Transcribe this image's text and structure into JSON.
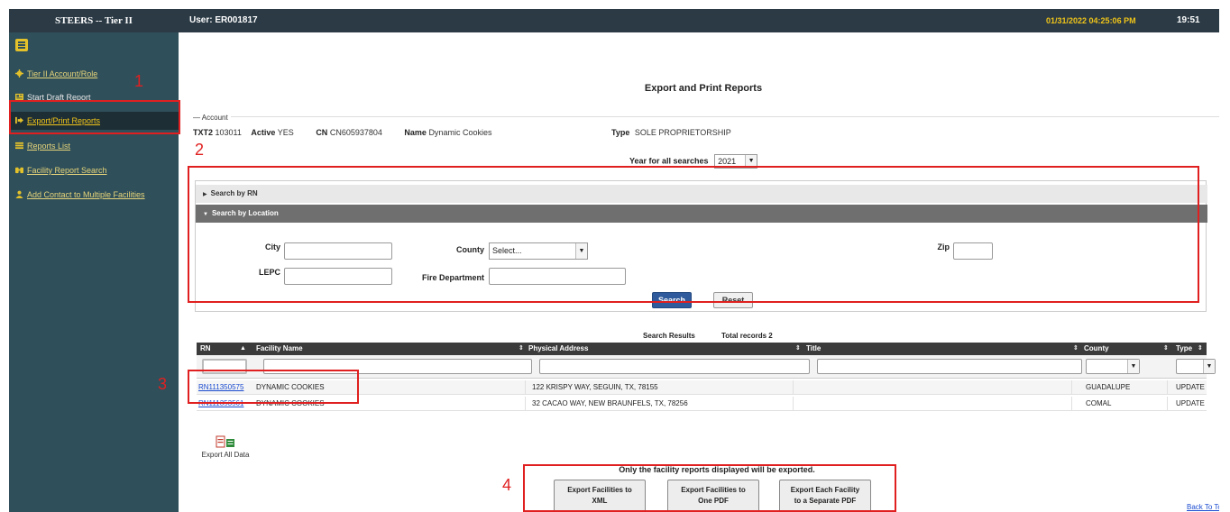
{
  "topbar": {
    "app_title": "STEERS -- Tier II",
    "user": "User: ER001817",
    "datetime": "01/31/2022 04:25:06 PM",
    "clock": "19:51"
  },
  "sidebar": {
    "items": [
      {
        "label": "Tier II Account/Role",
        "icon": "gear-icon"
      },
      {
        "label": "Start Draft Report",
        "icon": "newspaper-icon"
      },
      {
        "label": "Export/Print Reports",
        "icon": "sign-out-icon"
      },
      {
        "label": "Reports List",
        "icon": "list-icon"
      },
      {
        "label": "Facility Report Search",
        "icon": "binoculars-icon"
      },
      {
        "label": "Add Contact to Multiple Facilities",
        "icon": "user-icon"
      }
    ],
    "active_index": 2
  },
  "page": {
    "title": "Export and Print Reports"
  },
  "account": {
    "legend": "Account",
    "txt2_label": "TXT2",
    "txt2_value": "103011",
    "active_label": "Active",
    "active_value": "YES",
    "cn_label": "CN",
    "cn_value": "CN605937804",
    "name_label": "Name",
    "name_value": "Dynamic Cookies",
    "type_label": "Type",
    "type_value": "SOLE PROPRIETORSHIP"
  },
  "year": {
    "label": "Year for all searches",
    "value": "2021"
  },
  "search": {
    "by_rn_label": "Search by RN",
    "by_location_label": "Search by Location",
    "city_label": "City",
    "county_label": "County",
    "county_placeholder": "Select...",
    "zip_label": "Zip",
    "lepc_label": "LEPC",
    "fire_label": "Fire Department",
    "search_btn": "Search",
    "reset_btn": "Reset"
  },
  "results": {
    "title": "Search Results",
    "total": "Total records 2",
    "columns": {
      "rn": "RN",
      "facility": "Facility Name",
      "address": "Physical Address",
      "title": "Title",
      "county": "County",
      "type": "Type"
    },
    "rows": [
      {
        "rn": "RN111350575",
        "facility": "DYNAMIC COOKIES",
        "address": "122 KRISPY WAY, SEGUIN, TX, 78155",
        "title": "",
        "county": "GUADALUPE",
        "type": "UPDATE"
      },
      {
        "rn": "RN111353561",
        "facility": "DYNAMIC COOKIES",
        "address": "32 CACAO WAY, NEW BRAUNFELS, TX, 78256",
        "title": "",
        "county": "COMAL",
        "type": "UPDATE"
      }
    ]
  },
  "export": {
    "all_label": "Export All Data",
    "note": "Only the facility reports displayed will be exported.",
    "xml_line1": "Export Facilities to",
    "xml_line2": "XML",
    "pdf_line1": "Export Facilities to",
    "pdf_line2": "One PDF",
    "sep_line1": "Export Each Facility",
    "sep_line2": "to a Separate PDF",
    "back_to_top": "Back To Top"
  },
  "annotations": {
    "n1": "1",
    "n2": "2",
    "n3": "3",
    "n4": "4",
    "color": "#e02020"
  }
}
